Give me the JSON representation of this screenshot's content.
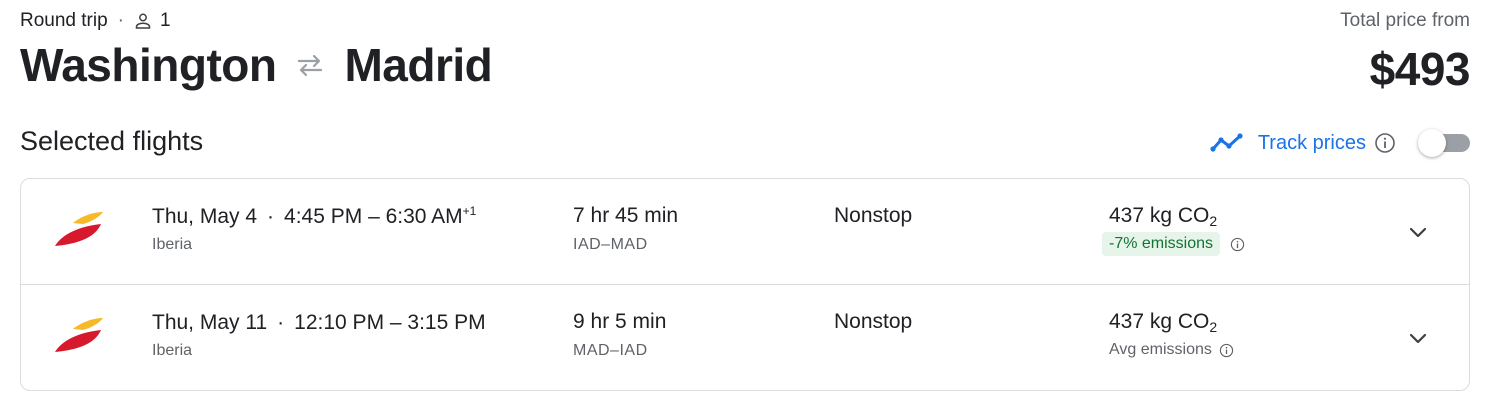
{
  "trip": {
    "type": "Round trip",
    "dot": "·",
    "passengers": "1",
    "origin": "Washington",
    "destination": "Madrid",
    "price_label": "Total price from",
    "price": "$493"
  },
  "section": {
    "title": "Selected flights",
    "track_label": "Track prices",
    "track_enabled": false,
    "accent_color": "#1a73e8"
  },
  "flights": [
    {
      "date": "Thu, May 4",
      "dot": "·",
      "times": "4:45 PM – 6:30 AM",
      "day_offset": "+1",
      "airline": "Iberia",
      "duration": "7 hr 45 min",
      "airports": "IAD–MAD",
      "stops": "Nonstop",
      "co2": "437 kg CO",
      "co2_sub": "2",
      "emissions": "-7% emissions",
      "emissions_highlight": true
    },
    {
      "date": "Thu, May 11",
      "dot": "·",
      "times": "12:10 PM – 3:15 PM",
      "day_offset": "",
      "airline": "Iberia",
      "duration": "9 hr 5 min",
      "airports": "MAD–IAD",
      "stops": "Nonstop",
      "co2": "437 kg CO",
      "co2_sub": "2",
      "emissions": "Avg emissions",
      "emissions_highlight": false
    }
  ],
  "icons": {
    "person": "person-icon",
    "swap": "swap-arrows-icon",
    "trend": "trend-line-icon",
    "info": "info-icon",
    "expand": "chevron-down-icon",
    "airline_logo": "iberia-logo"
  }
}
